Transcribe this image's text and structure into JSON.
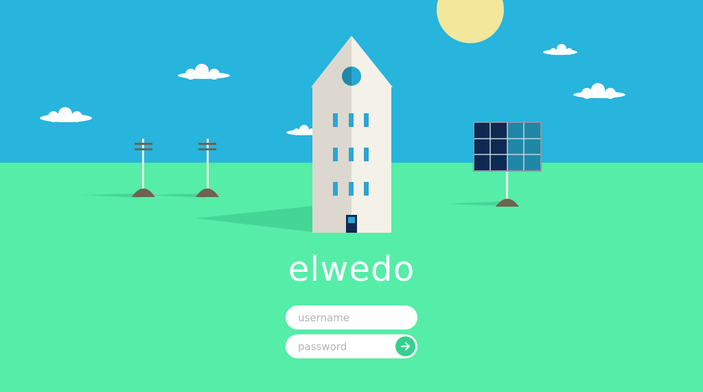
{
  "brand": {
    "name": "elwedo"
  },
  "login": {
    "username_placeholder": "username",
    "password_placeholder": "password",
    "submit_icon": "arrow-right-icon"
  },
  "colors": {
    "sky": "#27b4dd",
    "grass": "#55eda8",
    "sun": "#f2e79b",
    "building_light": "#f4f1e8",
    "building_shade": "#dcd8cf",
    "window": "#2aa6d3",
    "door": "#0f2a52",
    "solar_panel": "#0f2a52",
    "submit_button": "#37cf8e"
  }
}
